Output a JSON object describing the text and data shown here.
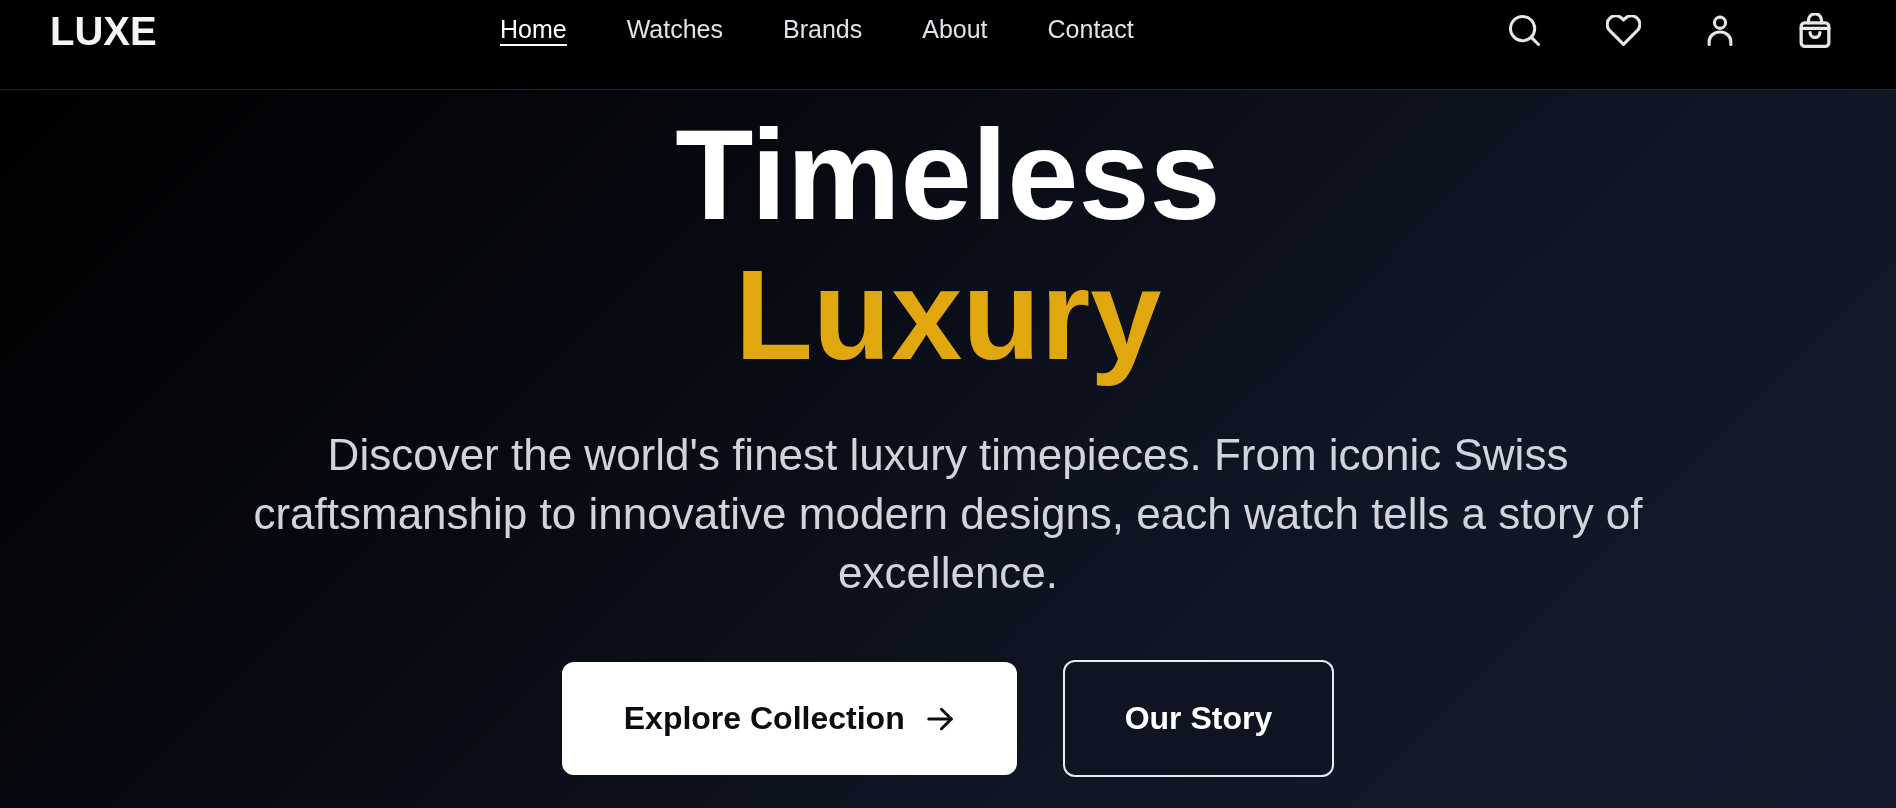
{
  "header": {
    "logo": "LUXE",
    "nav": [
      {
        "label": "Home",
        "selected": true
      },
      {
        "label": "Watches",
        "selected": false
      },
      {
        "label": "Brands",
        "selected": false
      },
      {
        "label": "About",
        "selected": false
      },
      {
        "label": "Contact",
        "selected": false
      }
    ]
  },
  "hero": {
    "title": "Timeless",
    "title_accent": "Luxury",
    "description": "Discover the world's finest luxury timepieces. From iconic Swiss craftsmanship to innovative modern designs, each watch tells a story of excellence.",
    "buttons": [
      {
        "label": "Explore Collection",
        "kind": "primary"
      },
      {
        "label": "Our Story",
        "kind": "outline"
      }
    ]
  }
}
